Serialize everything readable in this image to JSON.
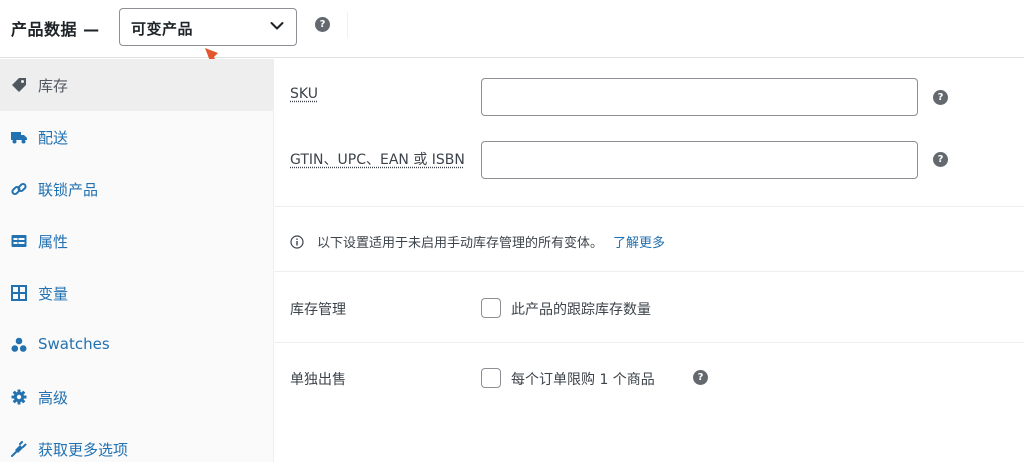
{
  "header": {
    "title": "产品数据 —",
    "product_type": "可变产品",
    "help_glyph": "?"
  },
  "sidebar": {
    "items": [
      {
        "label": "库存",
        "icon": "tag-icon",
        "active": true
      },
      {
        "label": "配送",
        "icon": "truck-icon"
      },
      {
        "label": "联锁产品",
        "icon": "link-icon"
      },
      {
        "label": "属性",
        "icon": "list-card-icon"
      },
      {
        "label": "变量",
        "icon": "grid-icon"
      },
      {
        "label": "Swatches",
        "icon": "swatches-icon"
      },
      {
        "label": "高级",
        "icon": "gear-icon"
      },
      {
        "label": "获取更多选项",
        "icon": "plugin-icon"
      }
    ]
  },
  "inventory": {
    "sku_label": "SKU",
    "sku_value": "",
    "gtin_label": "GTIN、UPC、EAN 或 ISBN",
    "gtin_value": "",
    "notice_text": "以下设置适用于未启用手动库存管理的所有变体。",
    "notice_link": "了解更多",
    "stock_mgmt_label": "库存管理",
    "stock_mgmt_checkbox": "此产品的跟踪库存数量",
    "stock_mgmt_checked": false,
    "sold_individually_label": "单独出售",
    "sold_individually_checkbox": "每个订单限购 1 个商品",
    "sold_individually_checked": false
  },
  "colors": {
    "link": "#2271b1",
    "arrow": "#e4572e",
    "active_bg": "#eeeeee"
  }
}
